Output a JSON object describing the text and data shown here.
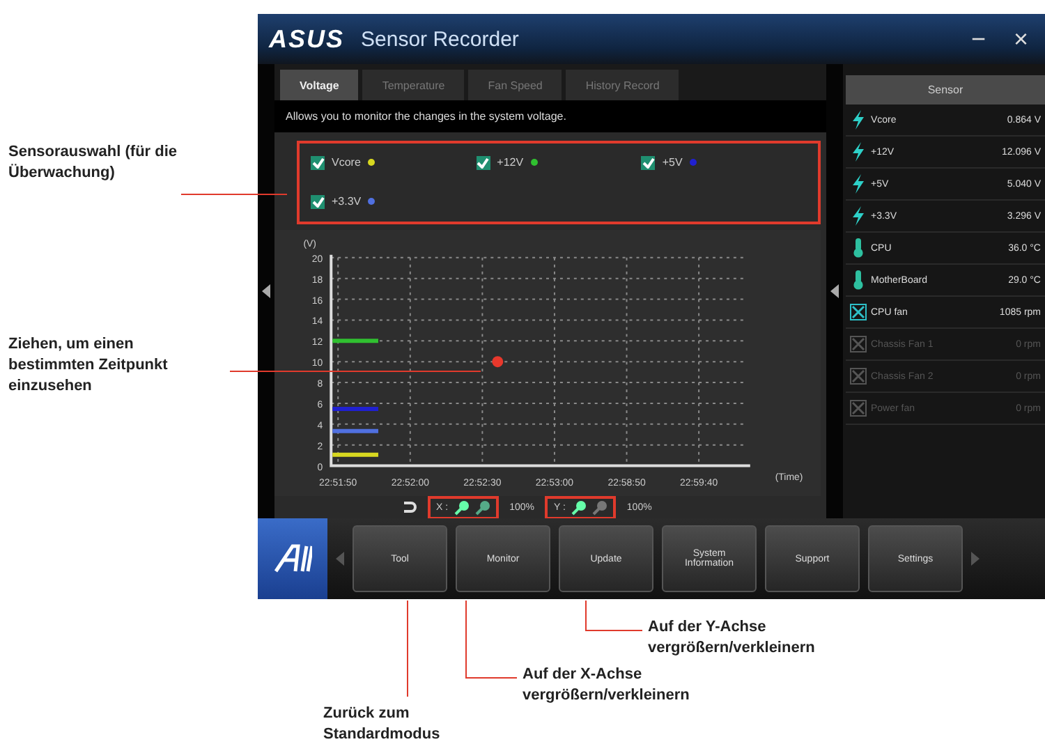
{
  "window": {
    "logo": "ASUS",
    "title": "Sensor Recorder",
    "minimize": "−",
    "close": "×"
  },
  "tabs": [
    {
      "label": "Voltage",
      "selected": true
    },
    {
      "label": "Temperature",
      "selected": false
    },
    {
      "label": "Fan Speed",
      "selected": false
    },
    {
      "label": "History Record",
      "selected": false
    }
  ],
  "description": "Allows you to monitor the changes in the system voltage.",
  "sensor_checks": [
    {
      "label": "Vcore",
      "checked": true,
      "color": "#d8d820"
    },
    {
      "label": "+12V",
      "checked": true,
      "color": "#30c030"
    },
    {
      "label": "+5V",
      "checked": true,
      "color": "#2020d0"
    },
    {
      "label": "+3.3V",
      "checked": true,
      "color": "#5070e0"
    }
  ],
  "chart": {
    "y_unit": "(V)",
    "x_unit": "(Time)",
    "y_ticks": [
      "20",
      "18",
      "16",
      "14",
      "12",
      "10",
      "8",
      "6",
      "4",
      "2",
      "0"
    ],
    "x_labels": [
      "22:51:50",
      "22:52:00",
      "22:52:30",
      "22:53:00",
      "22:58:50",
      "22:59:40"
    ]
  },
  "zoom_controls": {
    "x_label": "X :",
    "x_value": "100%",
    "y_label": "Y :",
    "y_value": "100%"
  },
  "sensor_panel": {
    "title": "Sensor",
    "rows": [
      {
        "kind": "voltage",
        "name": "Vcore",
        "value": "0.864 V",
        "disabled": false
      },
      {
        "kind": "voltage",
        "name": "+12V",
        "value": "12.096 V",
        "disabled": false
      },
      {
        "kind": "voltage",
        "name": "+5V",
        "value": "5.040 V",
        "disabled": false
      },
      {
        "kind": "voltage",
        "name": "+3.3V",
        "value": "3.296 V",
        "disabled": false
      },
      {
        "kind": "temperature",
        "name": "CPU",
        "value": "36.0 °C",
        "disabled": false
      },
      {
        "kind": "temperature",
        "name": "MotherBoard",
        "value": "29.0 °C",
        "disabled": false
      },
      {
        "kind": "fan",
        "name": "CPU fan",
        "value": "1085 rpm",
        "disabled": false
      },
      {
        "kind": "fan",
        "name": "Chassis Fan 1",
        "value": "0 rpm",
        "disabled": true
      },
      {
        "kind": "fan",
        "name": "Chassis Fan 2",
        "value": "0 rpm",
        "disabled": true
      },
      {
        "kind": "fan",
        "name": "Power fan",
        "value": "0 rpm",
        "disabled": true
      }
    ]
  },
  "dock": [
    "Tool",
    "Monitor",
    "Update",
    "System Information",
    "Support",
    "Settings"
  ],
  "callouts": {
    "sensor_selection": "Sensorauswahl (für die Überwachung)",
    "drag": "Ziehen, um einen bestimmten Zeitpunkt einzusehen",
    "y_zoom": "Auf der Y-Achse vergrößern/verkleinern",
    "x_zoom": "Auf der X-Achse vergrößern/verkleinern",
    "reset": "Zurück zum Standardmodus"
  }
}
